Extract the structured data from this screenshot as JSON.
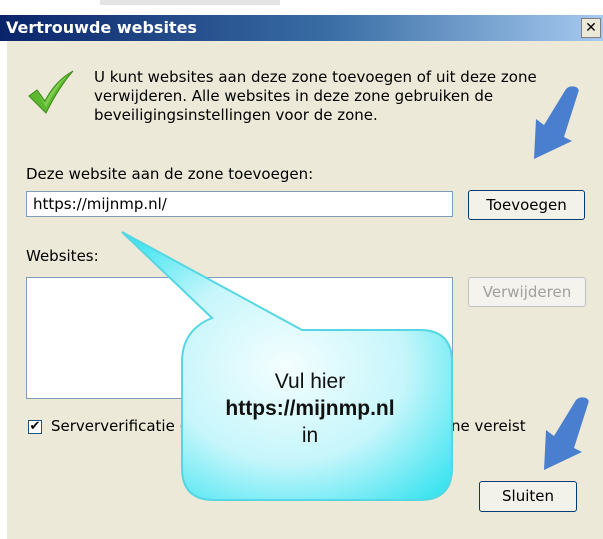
{
  "window": {
    "title": "Vertrouwde websites",
    "close_glyph": "✕"
  },
  "intro": {
    "text": "U kunt websites aan deze zone toevoegen of uit deze zone verwijderen. Alle websites in deze zone gebruiken de beveiligingsinstellingen voor de zone.",
    "icon": "checkmark-icon"
  },
  "add_section": {
    "label": "Deze website aan de zone toevoegen:",
    "input_value": "https://mijnmp.nl/",
    "add_button": "Toevoegen"
  },
  "websites_section": {
    "label": "Websites:",
    "items": [],
    "remove_button": "Verwijderen"
  },
  "server_verification": {
    "checked": true,
    "check_glyph": "✔",
    "label_left": "Serververificatie (",
    "label_right": "e zone vereist"
  },
  "close_button": "Sluiten",
  "callout": {
    "line1": "Vul hier",
    "line2": "https://mijnmp.nl",
    "line3": "in",
    "color": "#3fe4f0"
  },
  "colors": {
    "arrow": "#4a7fd0",
    "dialog_bg": "#ece9d8"
  }
}
